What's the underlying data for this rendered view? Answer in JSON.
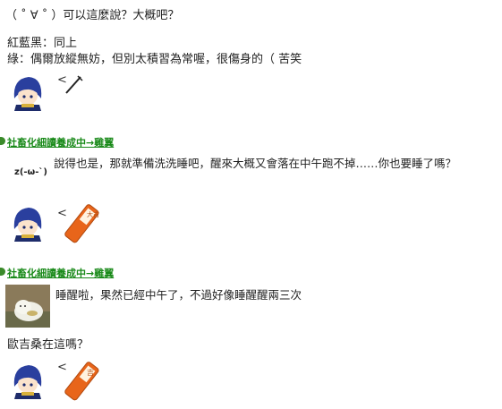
{
  "post1": {
    "line1": "（ ˚ ∀ ˚ ）可以這麼說？大概吧？",
    "line2": "紅藍黑：同上",
    "line3": "綠：偶爾放縱無妨，但別太積習為常喔，很傷身的（ 苦笑",
    "pointer": "<"
  },
  "post2": {
    "author": "社畜化細讀養成中→雞翼",
    "emoticon": "z(-ω-`)",
    "text": "說得也是，那就準備洗洗睡吧，醒來大概又會落在中午跑不掉……你也要睡了嗎？",
    "pointer": "<",
    "item_text": "大吉"
  },
  "post3": {
    "author": "社畜化細讀養成中→雞翼",
    "text": "睡醒啦，果然已經中午了，不過好像睡醒醒兩三次",
    "question": "歐吉桑在這嗎？",
    "pointer": "<",
    "item_text": "吉"
  },
  "colors": {
    "author_link": "#1a8a1a",
    "hair_blue": "#2a3f9e",
    "item_orange": "#e8651a"
  }
}
